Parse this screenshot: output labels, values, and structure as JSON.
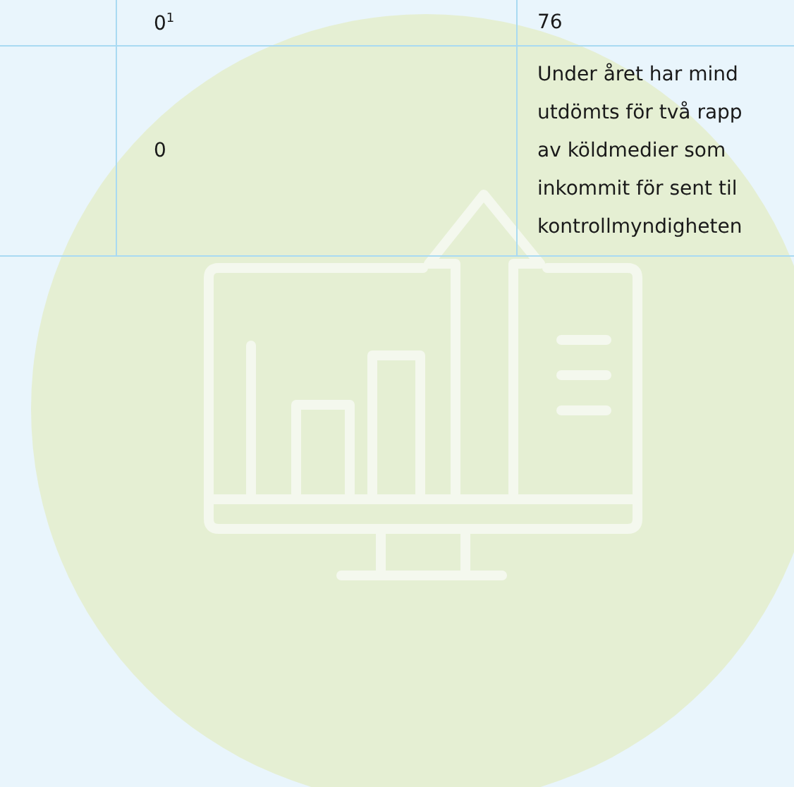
{
  "table": {
    "rows": [
      {
        "cells": [
          "",
          "0$^{1}$",
          "76"
        ]
      },
      {
        "cells": [
          "",
          "0",
          "Under året har mind\nutdömts för två rapp\nav köldmedier som\ninkommit för sent til\nkontrollmyndigheten"
        ]
      }
    ]
  }
}
